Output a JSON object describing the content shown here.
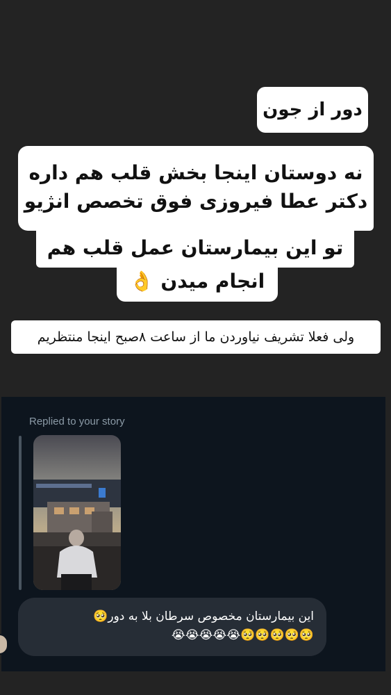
{
  "story": {
    "caption_1": "دور از جون",
    "caption_2_line1": "نه دوستان اینجا بخش قلب هم داره",
    "caption_2_line2": "دکتر عطا فیروزی فوق تخصص انژیو",
    "caption_2_line3": "تو این بیمارستان عمل قلب هم",
    "caption_2_line4": "انجام میدن 👌",
    "caption_3": "ولی فعلا تشریف نیاوردن ما از ساعت ۸صبح اینجا منتظریم"
  },
  "reply": {
    "label": "Replied to your story",
    "message_line1": "این بیمارستان  مخصوص  سرطان  بلا به دور🥺",
    "message_line2": "🥺🥺🥺🥺🥺😭😭😭😭😭"
  },
  "colors": {
    "story_bg": "#232323",
    "dm_bg": "#0d151e",
    "message_bubble": "#262d36",
    "label_text": "#8b9aa6"
  }
}
